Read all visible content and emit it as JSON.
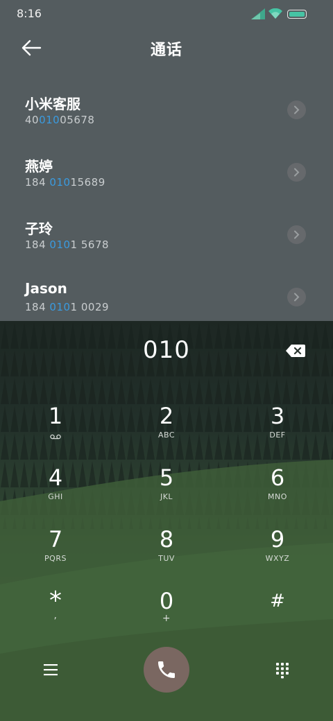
{
  "status": {
    "time": "8:16"
  },
  "header": {
    "title": "通话"
  },
  "contacts": [
    {
      "name": "小米客服",
      "number_pre": "40",
      "number_hl": "010",
      "number_post": "05678"
    },
    {
      "name": "燕婷",
      "number_pre": "184 ",
      "number_hl": "010",
      "number_post": "15689"
    },
    {
      "name": "子玲",
      "number_pre": "184 ",
      "number_hl": "010",
      "number_post": "1 5678"
    },
    {
      "name": "Jason",
      "number_pre": "184 ",
      "number_hl": "010",
      "number_post": "1 0029"
    }
  ],
  "dialer": {
    "input": "010",
    "keys": [
      {
        "digit": "1",
        "letters": "voicemail"
      },
      {
        "digit": "2",
        "letters": "ABC"
      },
      {
        "digit": "3",
        "letters": "DEF"
      },
      {
        "digit": "4",
        "letters": "GHI"
      },
      {
        "digit": "5",
        "letters": "JKL"
      },
      {
        "digit": "6",
        "letters": "MNO"
      },
      {
        "digit": "7",
        "letters": "PQRS"
      },
      {
        "digit": "8",
        "letters": "TUV"
      },
      {
        "digit": "9",
        "letters": "WXYZ"
      },
      {
        "digit": "*",
        "letters": ","
      },
      {
        "digit": "0",
        "letters": "+"
      },
      {
        "digit": "#",
        "letters": ""
      }
    ]
  },
  "colors": {
    "accent": "#3a9be0",
    "call_button": "#7a6761",
    "panel": "#545c5f"
  }
}
